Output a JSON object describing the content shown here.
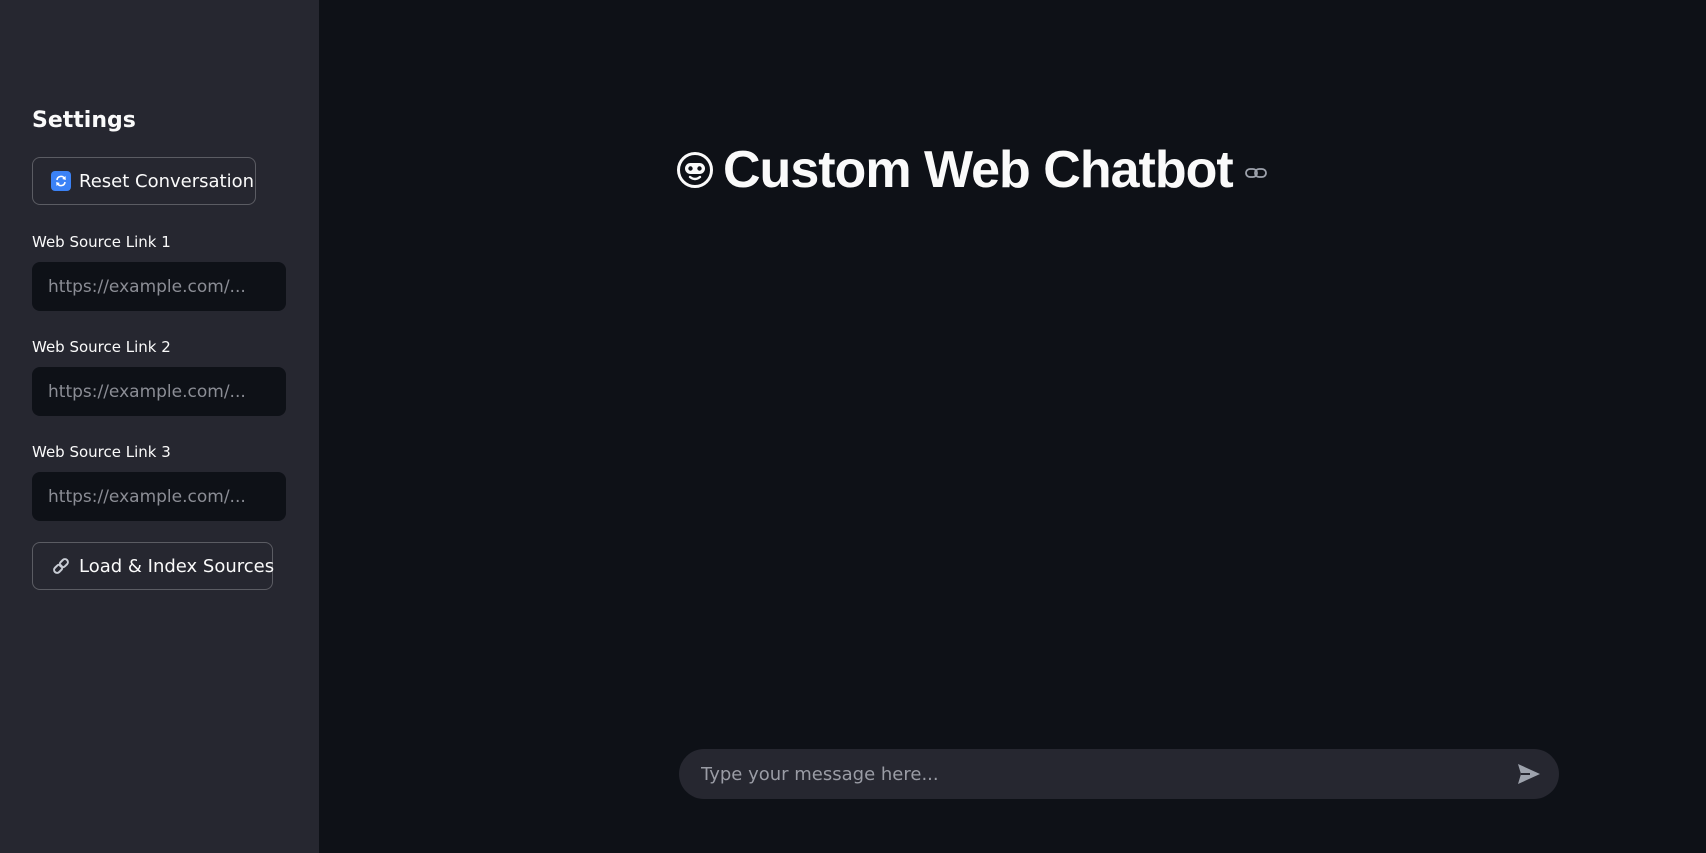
{
  "sidebar": {
    "title": "Settings",
    "reset_button": {
      "label": "Reset Conversation",
      "icon": "reset-arrows-icon"
    },
    "fields": [
      {
        "label": "Web Source Link 1",
        "placeholder": "https://example.com/...",
        "value": ""
      },
      {
        "label": "Web Source Link 2",
        "placeholder": "https://example.com/...",
        "value": ""
      },
      {
        "label": "Web Source Link 3",
        "placeholder": "https://example.com/...",
        "value": ""
      }
    ],
    "load_button": {
      "label": "Load & Index Sources",
      "icon": "link-icon"
    }
  },
  "main": {
    "title": "Custom Web Chatbot",
    "title_icon": "robot-face-icon",
    "anchor_icon": "link-icon"
  },
  "chat_input": {
    "placeholder": "Type your message here...",
    "send_icon": "send-icon"
  },
  "colors": {
    "sidebar_bg": "#262730",
    "main_bg": "#0e1117",
    "text": "#fafafa",
    "input_bg": "#0e1117",
    "chat_bar_bg": "#262730",
    "reset_icon_bg": "#3b82f6"
  }
}
